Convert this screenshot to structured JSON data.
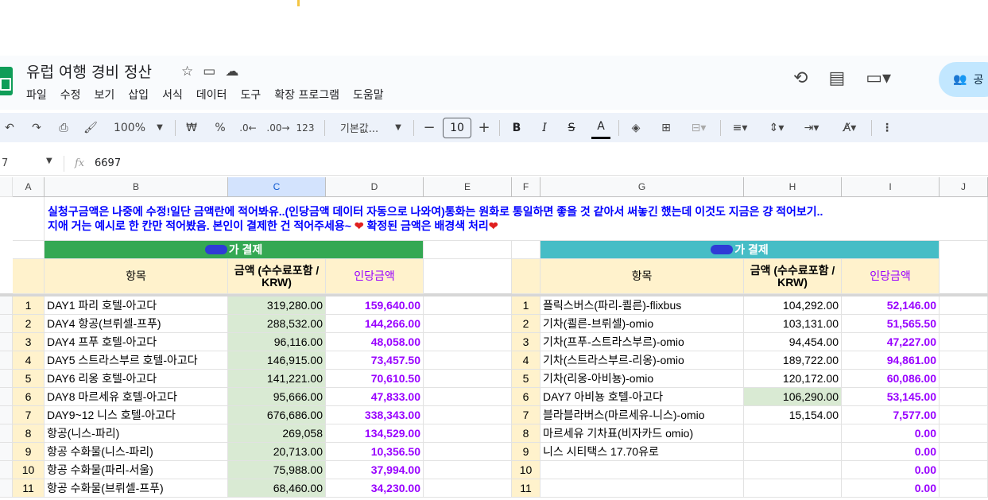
{
  "doc": {
    "title": "유럽 여행 경비 정산",
    "menu": [
      "파일",
      "수정",
      "보기",
      "삽입",
      "서식",
      "데이터",
      "도구",
      "확장 프로그램",
      "도움말"
    ],
    "share_label": "공"
  },
  "toolbar": {
    "zoom": "100%",
    "currency": "₩",
    "percent": "%",
    "dec_minus": ".0←",
    "dec_plus": ".00→",
    "format123": "123",
    "font": "기본값...",
    "font_size": "10",
    "bold": "B",
    "italic": "I",
    "strike": "S",
    "textcolor": "A"
  },
  "formula": {
    "cell_ref": "7",
    "fx": "fx",
    "value": "6697"
  },
  "columns": [
    "A",
    "B",
    "C",
    "D",
    "E",
    "F",
    "G",
    "H",
    "I",
    "J"
  ],
  "note": {
    "line1": "실청구금액은 나중에 수정!일단 금액란에 적어봐유..(인당금액 데이터 자동으로 나와여)통화는 원화로 통일하면 좋을 것 같아서 써놓긴 했는데 이것도 지금은 걍 적어보기..",
    "line2": "지애 거는 예시로 한 칸만 적어봤음. 본인이 결제한 건 적어주세용~ ",
    "line2b": " 확정된 금액은 배경색 처리",
    "heart": "❤"
  },
  "left_table": {
    "title": "가 결제",
    "headers": [
      "항목",
      "금액 (수수료포함 / KRW)",
      "인당금액"
    ],
    "rows": [
      {
        "n": "1",
        "item": "DAY1 파리 호텔-아고다",
        "amount": "319,280.00",
        "per": "159,640.00"
      },
      {
        "n": "2",
        "item": "DAY4 항공(브뤼셀-프푸)",
        "amount": "288,532.00",
        "per": "144,266.00"
      },
      {
        "n": "3",
        "item": "DAY4 프푸 호텔-아고다",
        "amount": "96,116.00",
        "per": "48,058.00"
      },
      {
        "n": "4",
        "item": "DAY5 스트라스부르 호텔-아고다",
        "amount": "146,915.00",
        "per": "73,457.50"
      },
      {
        "n": "5",
        "item": "DAY6 리옹 호텔-아고다",
        "amount": "141,221.00",
        "per": "70,610.50"
      },
      {
        "n": "6",
        "item": "DAY8 마르세유 호텔-아고다",
        "amount": "95,666.00",
        "per": "47,833.00"
      },
      {
        "n": "7",
        "item": "DAY9~12 니스 호텔-아고다",
        "amount": "676,686.00",
        "per": "338,343.00"
      },
      {
        "n": "8",
        "item": "항공(니스-파리)",
        "amount": "269,058",
        "per": "134,529.00"
      },
      {
        "n": "9",
        "item": "항공 수화물(니스-파리)",
        "amount": "20,713.00",
        "per": "10,356.50"
      },
      {
        "n": "10",
        "item": "항공 수화물(파리-서울)",
        "amount": "75,988.00",
        "per": "37,994.00"
      },
      {
        "n": "11",
        "item": "항공 수화물(브뤼셀-프푸)",
        "amount": "68,460.00",
        "per": "34,230.00"
      }
    ]
  },
  "right_table": {
    "title": "가 결제",
    "headers": [
      "항목",
      "금액 (수수료포함 / KRW)",
      "인당금액"
    ],
    "rows": [
      {
        "n": "1",
        "item": "플릭스버스(파리-쾰른)-flixbus",
        "amount": "104,292.00",
        "per": "52,146.00"
      },
      {
        "n": "2",
        "item": "기차(쾰른-브뤼셀)-omio",
        "amount": "103,131.00",
        "per": "51,565.50"
      },
      {
        "n": "3",
        "item": "기차(프푸-스트라스부르)-omio",
        "amount": "94,454.00",
        "per": "47,227.00"
      },
      {
        "n": "4",
        "item": "기차(스트라스부르-리옹)-omio",
        "amount": "189,722.00",
        "per": "94,861.00"
      },
      {
        "n": "5",
        "item": "기차(리옹-아비뇽)-omio",
        "amount": "120,172.00",
        "per": "60,086.00"
      },
      {
        "n": "6",
        "item": "DAY7 아비뇽 호텔-아고다",
        "amount": "106,290.00",
        "per": "53,145.00"
      },
      {
        "n": "7",
        "item": "블라블라버스(마르세유-니스)-omio",
        "amount": "15,154.00",
        "per": "7,577.00"
      },
      {
        "n": "8",
        "item": "마르세유 기차표(비자카드 omio)",
        "amount": "",
        "per": "0.00"
      },
      {
        "n": "9",
        "item": "니스 시티택스 17.70유로",
        "amount": "",
        "per": "0.00"
      },
      {
        "n": "10",
        "item": "",
        "amount": "",
        "per": "0.00"
      },
      {
        "n": "11",
        "item": "",
        "amount": "",
        "per": "0.00"
      }
    ]
  }
}
